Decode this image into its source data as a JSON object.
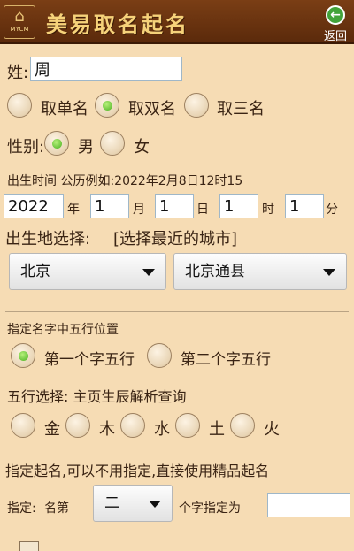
{
  "header": {
    "logo_text": "MYCM",
    "title": "美易取名起名",
    "back_label": "返回"
  },
  "surname": {
    "label": "姓:",
    "value": "周"
  },
  "name_mode": {
    "options": [
      "取单名",
      "取双名",
      "取三名"
    ],
    "selected": "取双名"
  },
  "gender": {
    "label": "性别:",
    "options": [
      "男",
      "女"
    ],
    "selected": "男"
  },
  "birth": {
    "hint": "出生时间 公历例如:2022年2月8日12时15",
    "year": "2022",
    "year_unit": "年",
    "month": "1",
    "month_unit": "月",
    "day": "1",
    "day_unit": "日",
    "hour": "1",
    "hour_unit": "时",
    "minute": "1",
    "minute_unit": "分"
  },
  "birthplace": {
    "label": "出生地选择:",
    "link": "[选择最近的城市]",
    "province": "北京",
    "city": "北京通县"
  },
  "wuxing_position": {
    "label": "指定名字中五行位置",
    "options": [
      "第一个字五行",
      "第二个字五行"
    ],
    "selected": "第一个字五行"
  },
  "wuxing_select": {
    "label": "五行选择: 主页生辰解析查询",
    "options": [
      "金",
      "木",
      "水",
      "土",
      "火"
    ]
  },
  "specify": {
    "note": "指定起名,可以不用指定,直接使用精品起名",
    "prefix": "指定:",
    "name_label": "名第",
    "position": "二",
    "suffix": "个字指定为",
    "value": ""
  }
}
